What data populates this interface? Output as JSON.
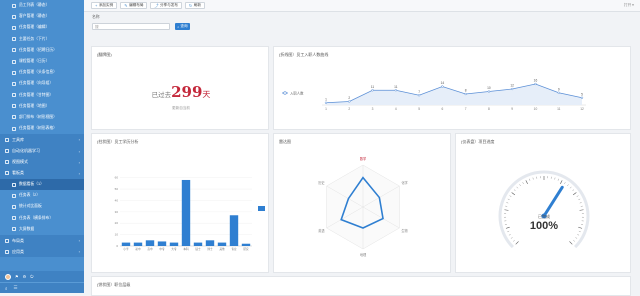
{
  "sidebar": {
    "items": [
      {
        "label": "员工列表（静态）",
        "type": "sub"
      },
      {
        "label": "客户管理（静态）",
        "type": "sub"
      },
      {
        "label": "任务管理（编辑）",
        "type": "sub"
      },
      {
        "label": "主要任务（下片）",
        "type": "sub"
      },
      {
        "label": "任务管理（招聘日历）",
        "type": "sub"
      },
      {
        "label": "课程管理（日历）",
        "type": "sub"
      },
      {
        "label": "任务管理（头条信息）",
        "type": "sub"
      },
      {
        "label": "任务管理（向导组）",
        "type": "sub"
      },
      {
        "label": "任务管理（甘特图）",
        "type": "sub"
      },
      {
        "label": "任务管理（地图）",
        "type": "sub"
      },
      {
        "label": "部门排布（树形视图）",
        "type": "sub"
      },
      {
        "label": "任务管理（树形表格）",
        "type": "sub"
      },
      {
        "label": "工具库",
        "type": "section"
      },
      {
        "label": "自动化机器学习",
        "type": "section"
      },
      {
        "label": "视图模式",
        "type": "section"
      },
      {
        "label": "看板类",
        "type": "section"
      },
      {
        "label": "数据看板（1）",
        "type": "sub",
        "active": true
      },
      {
        "label": "任务表（2）",
        "type": "sub"
      },
      {
        "label": "统计对比面板",
        "type": "sub"
      },
      {
        "label": "任务表（横条排布）",
        "type": "sub"
      },
      {
        "label": "大屏数据",
        "type": "sub"
      },
      {
        "label": "布局类",
        "type": "section"
      },
      {
        "label": "应用类",
        "type": "section"
      }
    ],
    "footer_tools": [
      "⚙",
      "≡",
      "☰"
    ]
  },
  "toolbar": {
    "buttons": [
      {
        "label": "添加实例",
        "glyph": "+"
      },
      {
        "label": "编辑布局",
        "glyph": "✎"
      },
      {
        "label": "分享与发布",
        "glyph": "⤴"
      },
      {
        "label": "刷新",
        "glyph": "↻"
      }
    ],
    "right_text": "打开 ▾"
  },
  "search": {
    "label": "名称",
    "placeholder": "搜",
    "button_label": "查询"
  },
  "panels": {
    "days": {
      "title": "(翻牌图)",
      "prefix": "已过去",
      "number": "299",
      "unit": "天",
      "caption": "更新自当前"
    },
    "line": {
      "title": "(折线图）员工入职人数曲线",
      "legend": "入职人数"
    },
    "bar": {
      "title": "(柱状图）员工学历分析",
      "legend": "学历人数"
    },
    "radar": {
      "title": "雷达图",
      "indicators": [
        "数学",
        "化学",
        "生物",
        "地理",
        "英语",
        "历史"
      ]
    },
    "gauge": {
      "title": "(仪表盘）项目进度",
      "label": "已完成",
      "value_text": "100%"
    },
    "bottom": {
      "title": "(饼状图）职位层级"
    }
  },
  "chart_data": [
    {
      "type": "line",
      "x": [
        2,
        3,
        4,
        5,
        6,
        7,
        8,
        9,
        10,
        11,
        12,
        13,
        14,
        15
      ],
      "values": [
        1,
        2,
        11,
        11,
        7,
        14,
        8,
        10,
        12,
        16,
        9,
        5
      ],
      "categories": [
        "1",
        "2",
        "3",
        "4",
        "5",
        "6",
        "7",
        "8",
        "9",
        "10",
        "11",
        "12"
      ],
      "ylim": [
        0,
        20
      ]
    },
    {
      "type": "bar",
      "categories": [
        "小学",
        "初中",
        "高中",
        "中专",
        "大专",
        "本科",
        "硕士",
        "博士",
        "其他",
        "专业",
        "研究"
      ],
      "values": [
        3,
        3,
        5,
        4,
        3,
        58,
        3,
        5,
        3,
        27,
        2
      ],
      "yticks": [
        0,
        10,
        20,
        30,
        40,
        50,
        60
      ],
      "ylim": [
        0,
        65
      ]
    },
    {
      "type": "radar",
      "values": [
        0.7,
        0.45,
        0.55,
        0.5,
        0.6,
        0.4
      ]
    },
    {
      "type": "gauge",
      "value": 100,
      "range": [
        0,
        100
      ]
    }
  ],
  "colors": {
    "primary": "#2f7fd1",
    "sidebar": "#4a8fcf",
    "accent_red": "#c4283b"
  }
}
